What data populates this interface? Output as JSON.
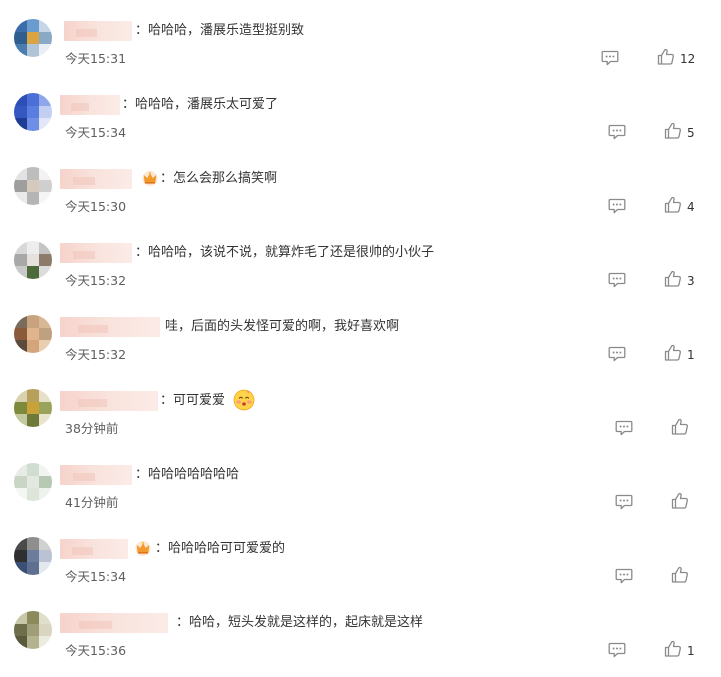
{
  "comments": [
    {
      "text": "：哈哈哈，潘展乐造型挺别致",
      "time": "今天15:31",
      "likes": "12",
      "avatar_colors": [
        "#3b6ea8",
        "#6a9ccf",
        "#c7d6e6",
        "#2f5f8f",
        "#d9a441",
        "#8aa9c4",
        "#4a7cb0",
        "#b0c4d8",
        "#e8eef3"
      ]
    },
    {
      "text": "：哈哈哈，潘展乐太可爱了",
      "time": "今天15:34",
      "likes": "5",
      "avatar_colors": [
        "#2d4fb5",
        "#4b6fd6",
        "#8fa6e8",
        "#3557c2",
        "#5a7ee0",
        "#c3cff2",
        "#1f3c94",
        "#6f8fe6",
        "#e1e7f8"
      ]
    },
    {
      "text": "：怎么会那么搞笑啊",
      "time": "今天15:30",
      "likes": "4",
      "avatar_colors": [
        "#e3e3e3",
        "#bdbdbd",
        "#f2f2f2",
        "#9e9e9e",
        "#d6c9bd",
        "#cfcfcf",
        "#eaeaea",
        "#b5b5b5",
        "#f5f5f5"
      ]
    },
    {
      "text": "：哈哈哈，该说不说，就算炸毛了还是很帅的小伙子",
      "time": "今天15:32",
      "likes": "3",
      "avatar_colors": [
        "#d8d8d8",
        "#ededed",
        "#c4c4c4",
        "#a8a8a8",
        "#e6e1dc",
        "#8c7b6a",
        "#c9c9c9",
        "#4d6b3a",
        "#dcdcdc"
      ]
    },
    {
      "text": "哇，后面的头发怪可爱的啊，我好喜欢啊",
      "time": "今天15:32",
      "likes": "1",
      "avatar_colors": [
        "#7a6b5d",
        "#c9a27e",
        "#d8b894",
        "#8a5a3a",
        "#e0b48d",
        "#bfa080",
        "#5c4a3d",
        "#d4a57b",
        "#e9cdb0"
      ]
    },
    {
      "text": "：可可爱爱",
      "time": "38分钟前",
      "likes": "",
      "avatar_colors": [
        "#d9d2b0",
        "#b8a05a",
        "#e6e0c8",
        "#7d8a3c",
        "#c9a33a",
        "#9aa35a",
        "#c4c9a0",
        "#6e7a3a",
        "#e8e4cc"
      ]
    },
    {
      "text": "：哈哈哈哈哈哈哈",
      "time": "41分钟前",
      "likes": "",
      "avatar_colors": [
        "#e8ece6",
        "#d1ddd0",
        "#f1f4f0",
        "#c9d6c6",
        "#e3e9e1",
        "#b7c9b3",
        "#f4f6f3",
        "#dde5da",
        "#eef2ec"
      ]
    },
    {
      "text": "：哈哈哈哈可可爱爱的",
      "time": "今天15:34",
      "likes": "",
      "avatar_colors": [
        "#4a4a4a",
        "#8e8e8e",
        "#d0d0d0",
        "#2f2f2f",
        "#6b7d9b",
        "#b9c3d3",
        "#3b4f75",
        "#5e6f90",
        "#e3e7ee"
      ]
    },
    {
      "text": "：哈哈，短头发就是这样的，起床就是这样",
      "time": "今天15:36",
      "likes": "1",
      "avatar_colors": [
        "#c8c8a8",
        "#8a8a5a",
        "#e0dfcc",
        "#6e6e4a",
        "#9f9e78",
        "#d8d6c0",
        "#5a5a3c",
        "#b4b38f",
        "#ecebdf"
      ]
    }
  ],
  "icons": {
    "badge": "crown-badge-icon",
    "emoji": "blushing-face-emoji",
    "reply": "comment-reply-icon",
    "like": "thumbs-up-icon"
  },
  "colors": {
    "text": "#333333",
    "time": "#5e5e5e",
    "icon": "#8a8a8a",
    "username_blur": "#f6d3cb"
  }
}
